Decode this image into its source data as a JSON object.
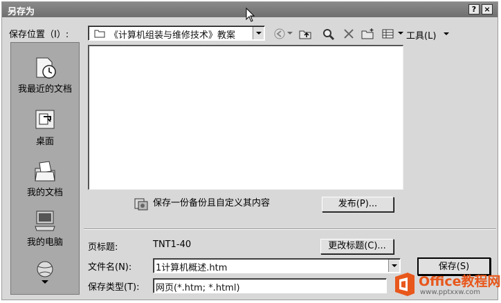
{
  "window": {
    "title": "另存为"
  },
  "titlebar": {
    "help": "?",
    "close": "×"
  },
  "location": {
    "label": "保存位置（I）:",
    "value": "《计算机组装与维修技术》教案"
  },
  "toolbar": {
    "tools_label": "工具(L)"
  },
  "places": [
    {
      "label": "我最近的文档",
      "icon": "recent-documents-icon"
    },
    {
      "label": "桌面",
      "icon": "desktop-icon"
    },
    {
      "label": "我的文档",
      "icon": "my-documents-icon"
    },
    {
      "label": "我的电脑",
      "icon": "my-computer-icon"
    }
  ],
  "save_option": {
    "text": "保存一份备份且自定义其内容",
    "publish_button": "发布(P)..."
  },
  "page_title": {
    "label": "页标题:",
    "value": "TNT1-40",
    "change_button": "更改标题(C)..."
  },
  "filename": {
    "label": "文件名(N):",
    "value": "1计算机概述.htm"
  },
  "filetype": {
    "label": "保存类型(T):",
    "value": "网页(*.htm; *.html)"
  },
  "buttons": {
    "save": "保存(S)"
  },
  "watermark": {
    "brand": "Office教程网",
    "url": "www.pptxxw.com"
  }
}
